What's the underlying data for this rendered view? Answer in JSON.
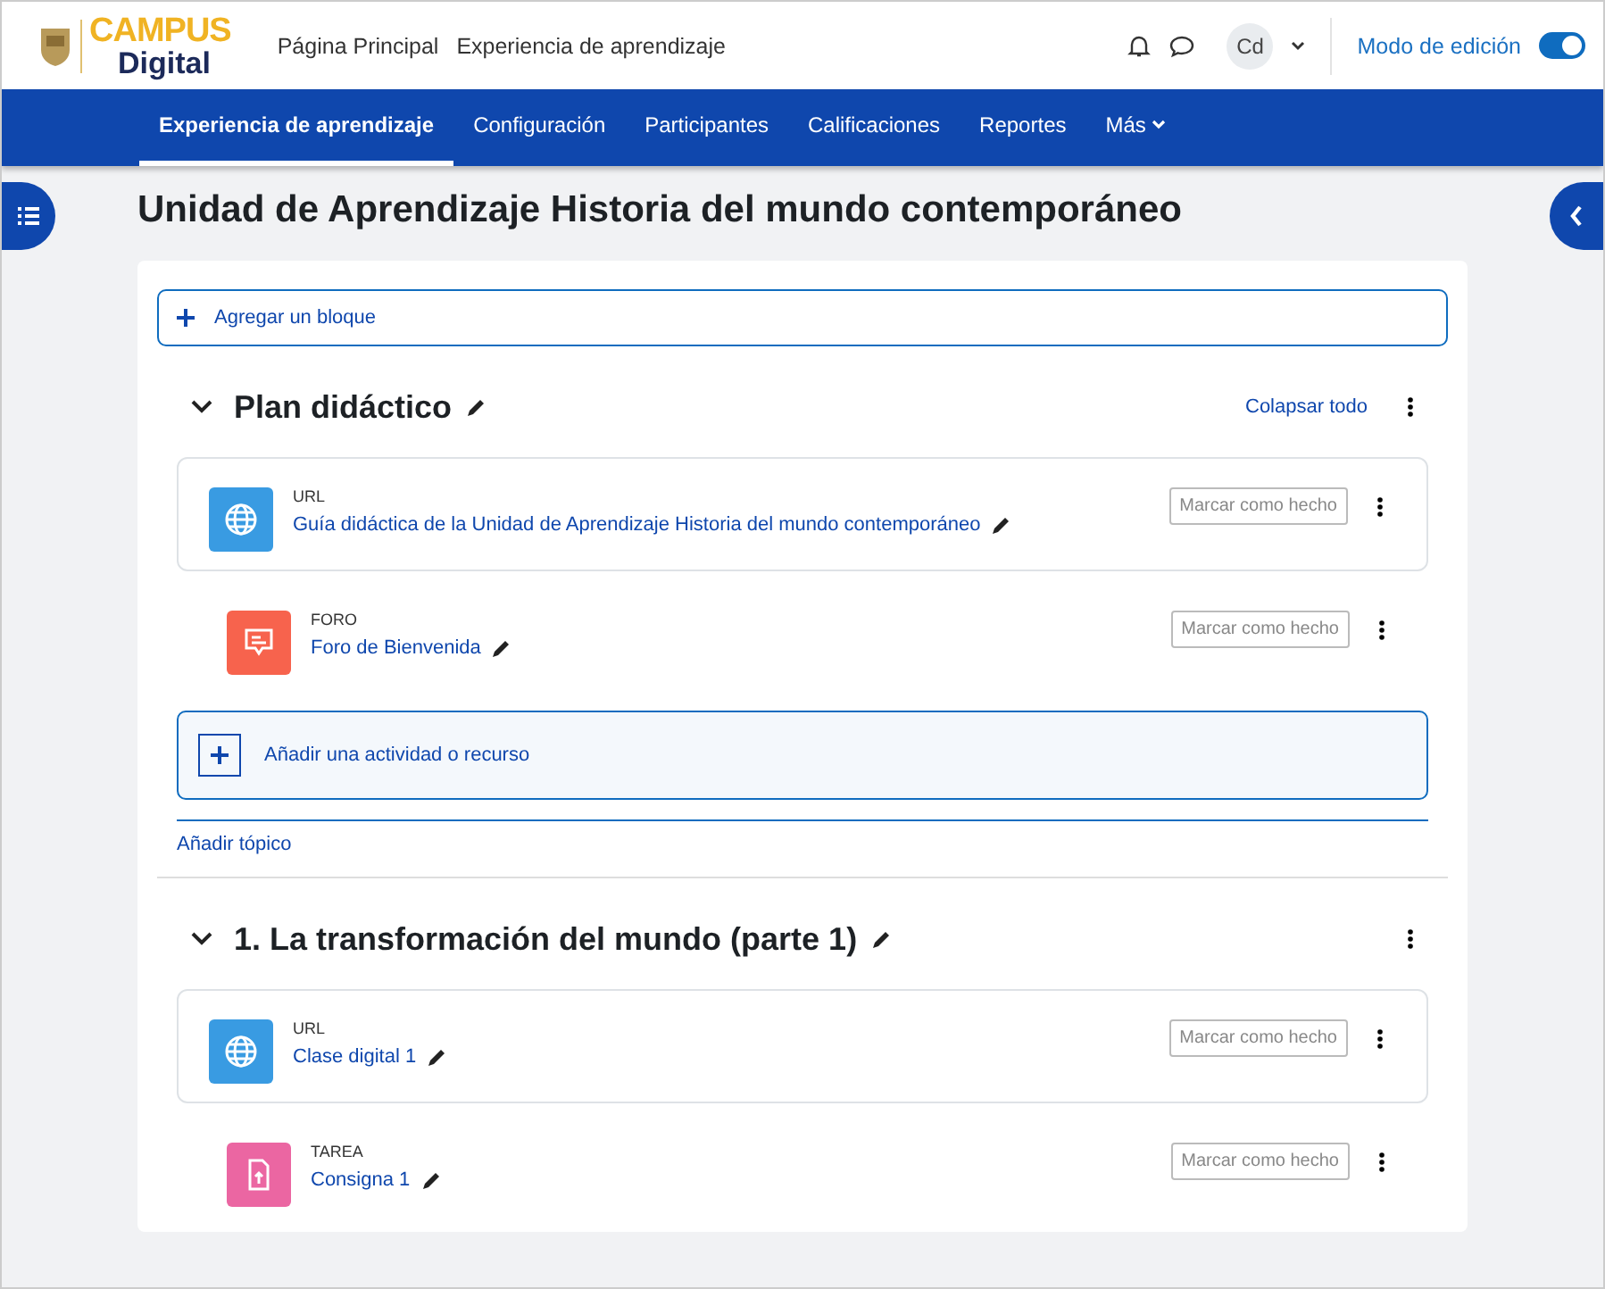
{
  "logo": {
    "line_1": "CAMPUS",
    "line_2": "Digital"
  },
  "top_links": [
    "Página Principal",
    "Experiencia de aprendizaje"
  ],
  "user": {
    "initials": "Cd"
  },
  "edit_mode": {
    "label": "Modo de edición",
    "on": true
  },
  "tabs": [
    {
      "label": "Experiencia de aprendizaje",
      "selected": true
    },
    {
      "label": "Configuración",
      "selected": false
    },
    {
      "label": "Participantes",
      "selected": false
    },
    {
      "label": "Calificaciones",
      "selected": false
    },
    {
      "label": "Reportes",
      "selected": false
    },
    {
      "label": "Más",
      "selected": false
    }
  ],
  "page_title": "Unidad de Aprendizaje Historia del mundo contemporáneo",
  "add_block": "Agregar un bloque",
  "collapse_all": "Colapsar todo",
  "sections": [
    {
      "title": "Plan didáctico",
      "expanded": true,
      "activities": [
        {
          "kind": "url",
          "type_label": "URL",
          "name": "Guía didáctica de la Unidad de Aprendizaje Historia del mundo contemporáneo",
          "completion": "Marcar como hecho"
        },
        {
          "kind": "forum",
          "type_label": "FORO",
          "name": "Foro de Bienvenida",
          "completion": "Marcar como hecho"
        }
      ],
      "add_activity": "Añadir una actividad o recurso",
      "add_topic": "Añadir tópico"
    },
    {
      "title": "1. La transformación del mundo (parte 1)",
      "expanded": true,
      "activities": [
        {
          "kind": "url",
          "type_label": "URL",
          "name": "Clase digital 1",
          "completion": "Marcar como hecho"
        },
        {
          "kind": "assignment",
          "type_label": "TAREA",
          "name": "Consigna 1",
          "completion": "Marcar como hecho"
        }
      ]
    }
  ]
}
